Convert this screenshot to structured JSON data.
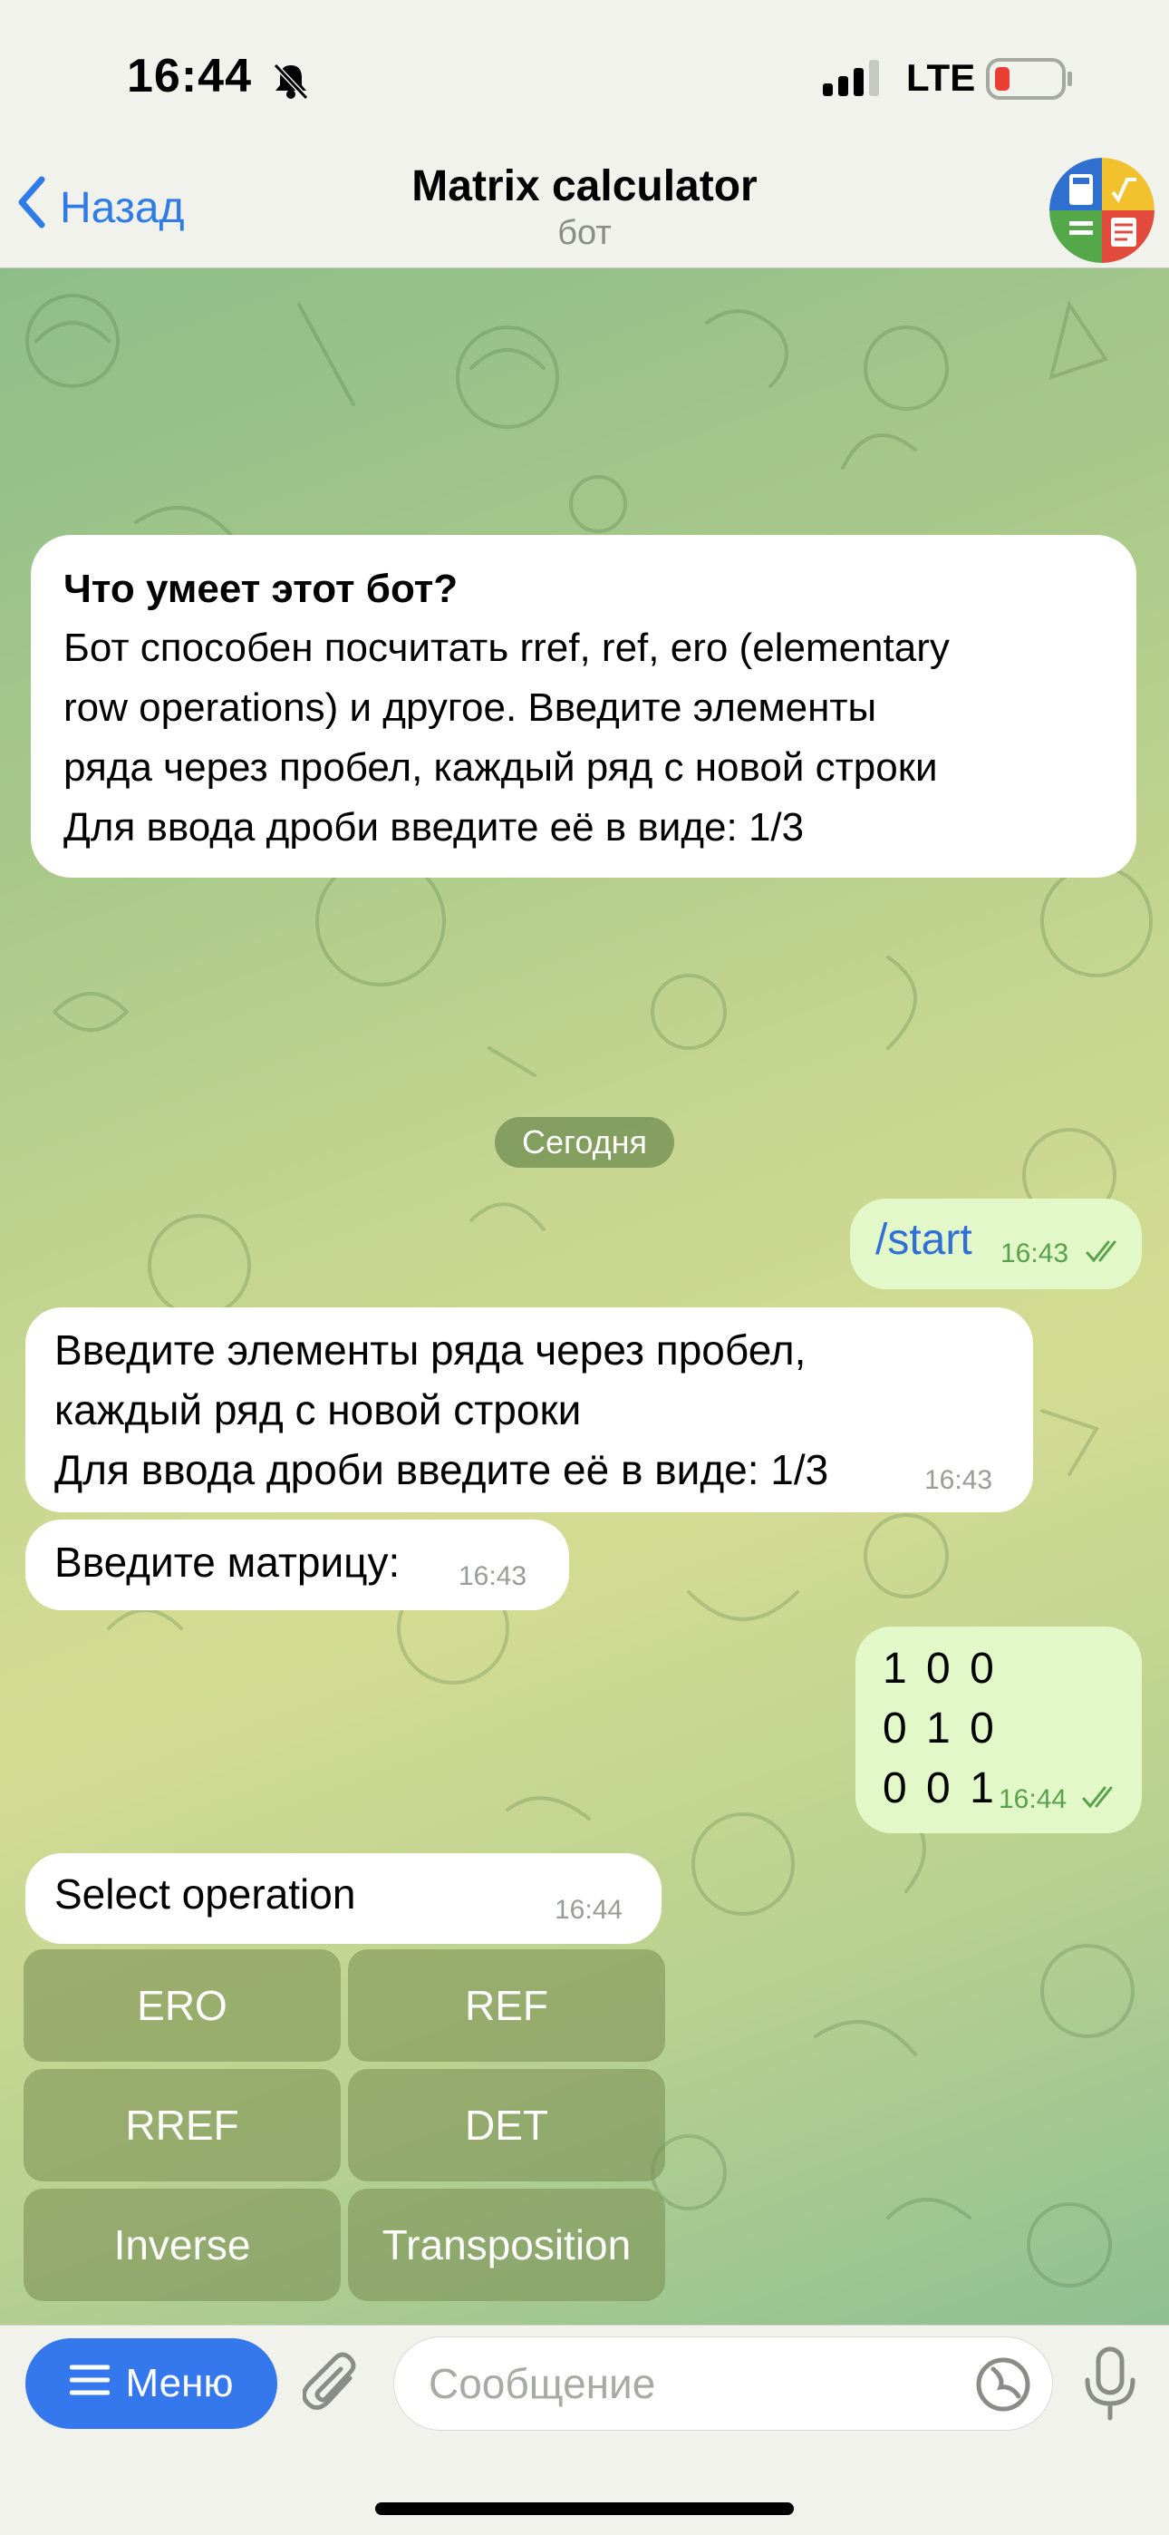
{
  "status": {
    "time": "16:44",
    "network": "LTE"
  },
  "header": {
    "back_label": "Назад",
    "title": "Matrix calculator",
    "subtitle": "бот"
  },
  "info": {
    "title": "Что умеет этот бот?",
    "body": "Бот способен посчитать rref, ref, ero (elementary\nrow operations) и другое. Введите элементы\nряда через пробел, каждый ряд с новой строки\nДля ввода дроби введите её в виде: 1/3"
  },
  "date_label": "Сегодня",
  "messages": [
    {
      "direction": "out",
      "text": "/start",
      "time": "16:43"
    },
    {
      "direction": "in",
      "text": "Введите элементы ряда через пробел,\nкаждый ряд с новой строки\nДля ввода дроби введите её в виде: 1/3",
      "time": "16:43"
    },
    {
      "direction": "in",
      "text": "Введите матрицу:",
      "time": "16:43"
    },
    {
      "direction": "out",
      "text": "1 0 0\n0 1 0\n0 0 1",
      "time": "16:44"
    },
    {
      "direction": "in",
      "text": "Select operation",
      "time": "16:44"
    }
  ],
  "keyboard": [
    "ERO",
    "REF",
    "RREF",
    "DET",
    "Inverse",
    "Transposition"
  ],
  "input": {
    "menu_label": "Меню",
    "placeholder": "Сообщение"
  },
  "colors": {
    "accent": "#3577ec",
    "outgoing_bubble": "#e3f8c9",
    "incoming_bubble": "#ffffff",
    "read_check": "#57a24a"
  }
}
